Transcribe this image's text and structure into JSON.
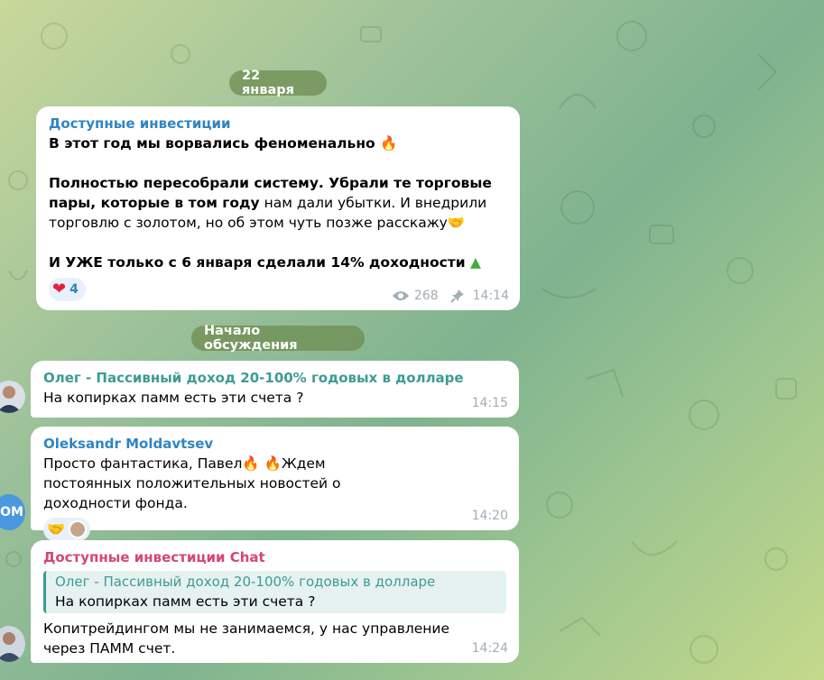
{
  "colors": {
    "link_blue": "#2f85c4",
    "author_teal": "#3d9b93",
    "author_pink": "#d5457a",
    "date_pill_bg": "#6e8c50",
    "heart_red": "#e0243b"
  },
  "date_divider": "22 января",
  "channel_post": {
    "author": "Доступные инвестиции",
    "line1": "В этот год мы ворвались феноменально",
    "line1_emoji": "fire-icon",
    "para2_bold": "Полностью пересобрали систему. Убрали те торговые пары, которые в том году",
    "para2_rest": " нам дали убытки. И внедрили торговлю с золотом, но об этом чуть позже расскажу",
    "para2_emoji": "handshake-icon",
    "para3": "И УЖЕ только с 6 января сделали 14% доходности",
    "para3_emoji": "christmas-tree-icon",
    "reaction": {
      "icon": "heart-icon",
      "count": "4"
    },
    "views": "268",
    "time": "14:14"
  },
  "discussion_divider": "Начало обсуждения",
  "messages": [
    {
      "author": "Олег - Пассивный доход 20-100% годовых в долларе",
      "text": "На копирках памм есть эти счета ?",
      "time": "14:15"
    },
    {
      "author": "Oleksandr Moldavtsev",
      "text_a": "Просто фантастика, Павел",
      "text_b": "Ждем постоянных положительных новостей о доходности фонда.",
      "avatar_initials": "OM",
      "time": "14:20"
    },
    {
      "author": "Доступные инвестиции Chat",
      "reply_author": "Олег - Пассивный доход 20-100% годовых в долларе",
      "reply_text": "На копирках памм есть эти счета ?",
      "text": "Копитрейдингом мы не занимаемся, у нас управление через ПАММ счет.",
      "time": "14:24"
    }
  ]
}
